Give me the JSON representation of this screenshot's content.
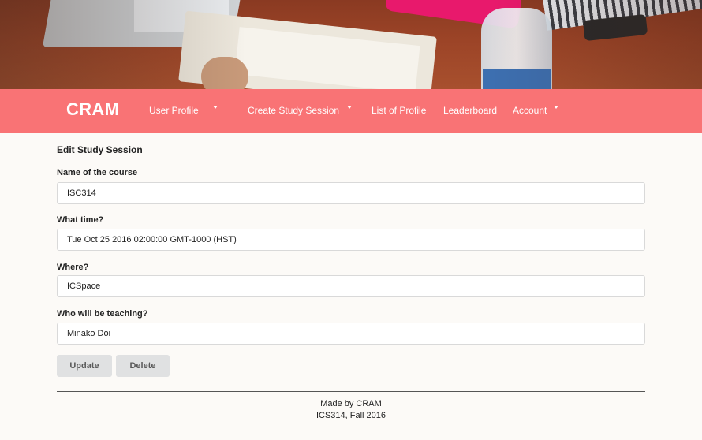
{
  "navbar": {
    "brand": "CRAM",
    "items": [
      {
        "label": "User Profile",
        "has_caret": true
      },
      {
        "label": "Create Study Session",
        "has_caret": true
      },
      {
        "label": "List of Profile",
        "has_caret": false
      },
      {
        "label": "Leaderboard",
        "has_caret": false
      },
      {
        "label": "Account",
        "has_caret": true
      }
    ]
  },
  "form": {
    "title": "Edit Study Session",
    "fields": [
      {
        "label": "Name of the course",
        "value": "ISC314"
      },
      {
        "label": "What time?",
        "value": "Tue Oct 25 2016 02:00:00 GMT-1000 (HST)"
      },
      {
        "label": "Where?",
        "value": "ICSpace"
      },
      {
        "label": "Who will be teaching?",
        "value": "Minako Doi"
      }
    ],
    "buttons": {
      "update": "Update",
      "delete": "Delete"
    }
  },
  "footer": {
    "line1": "Made by CRAM",
    "line2": "ICS314, Fall 2016"
  },
  "colors": {
    "navbar": "#f97375",
    "button": "#e0e1e2",
    "background": "#fcfaf7"
  },
  "icons": {
    "dropdown": "caret-down-icon",
    "hero": "study-table-photo"
  }
}
